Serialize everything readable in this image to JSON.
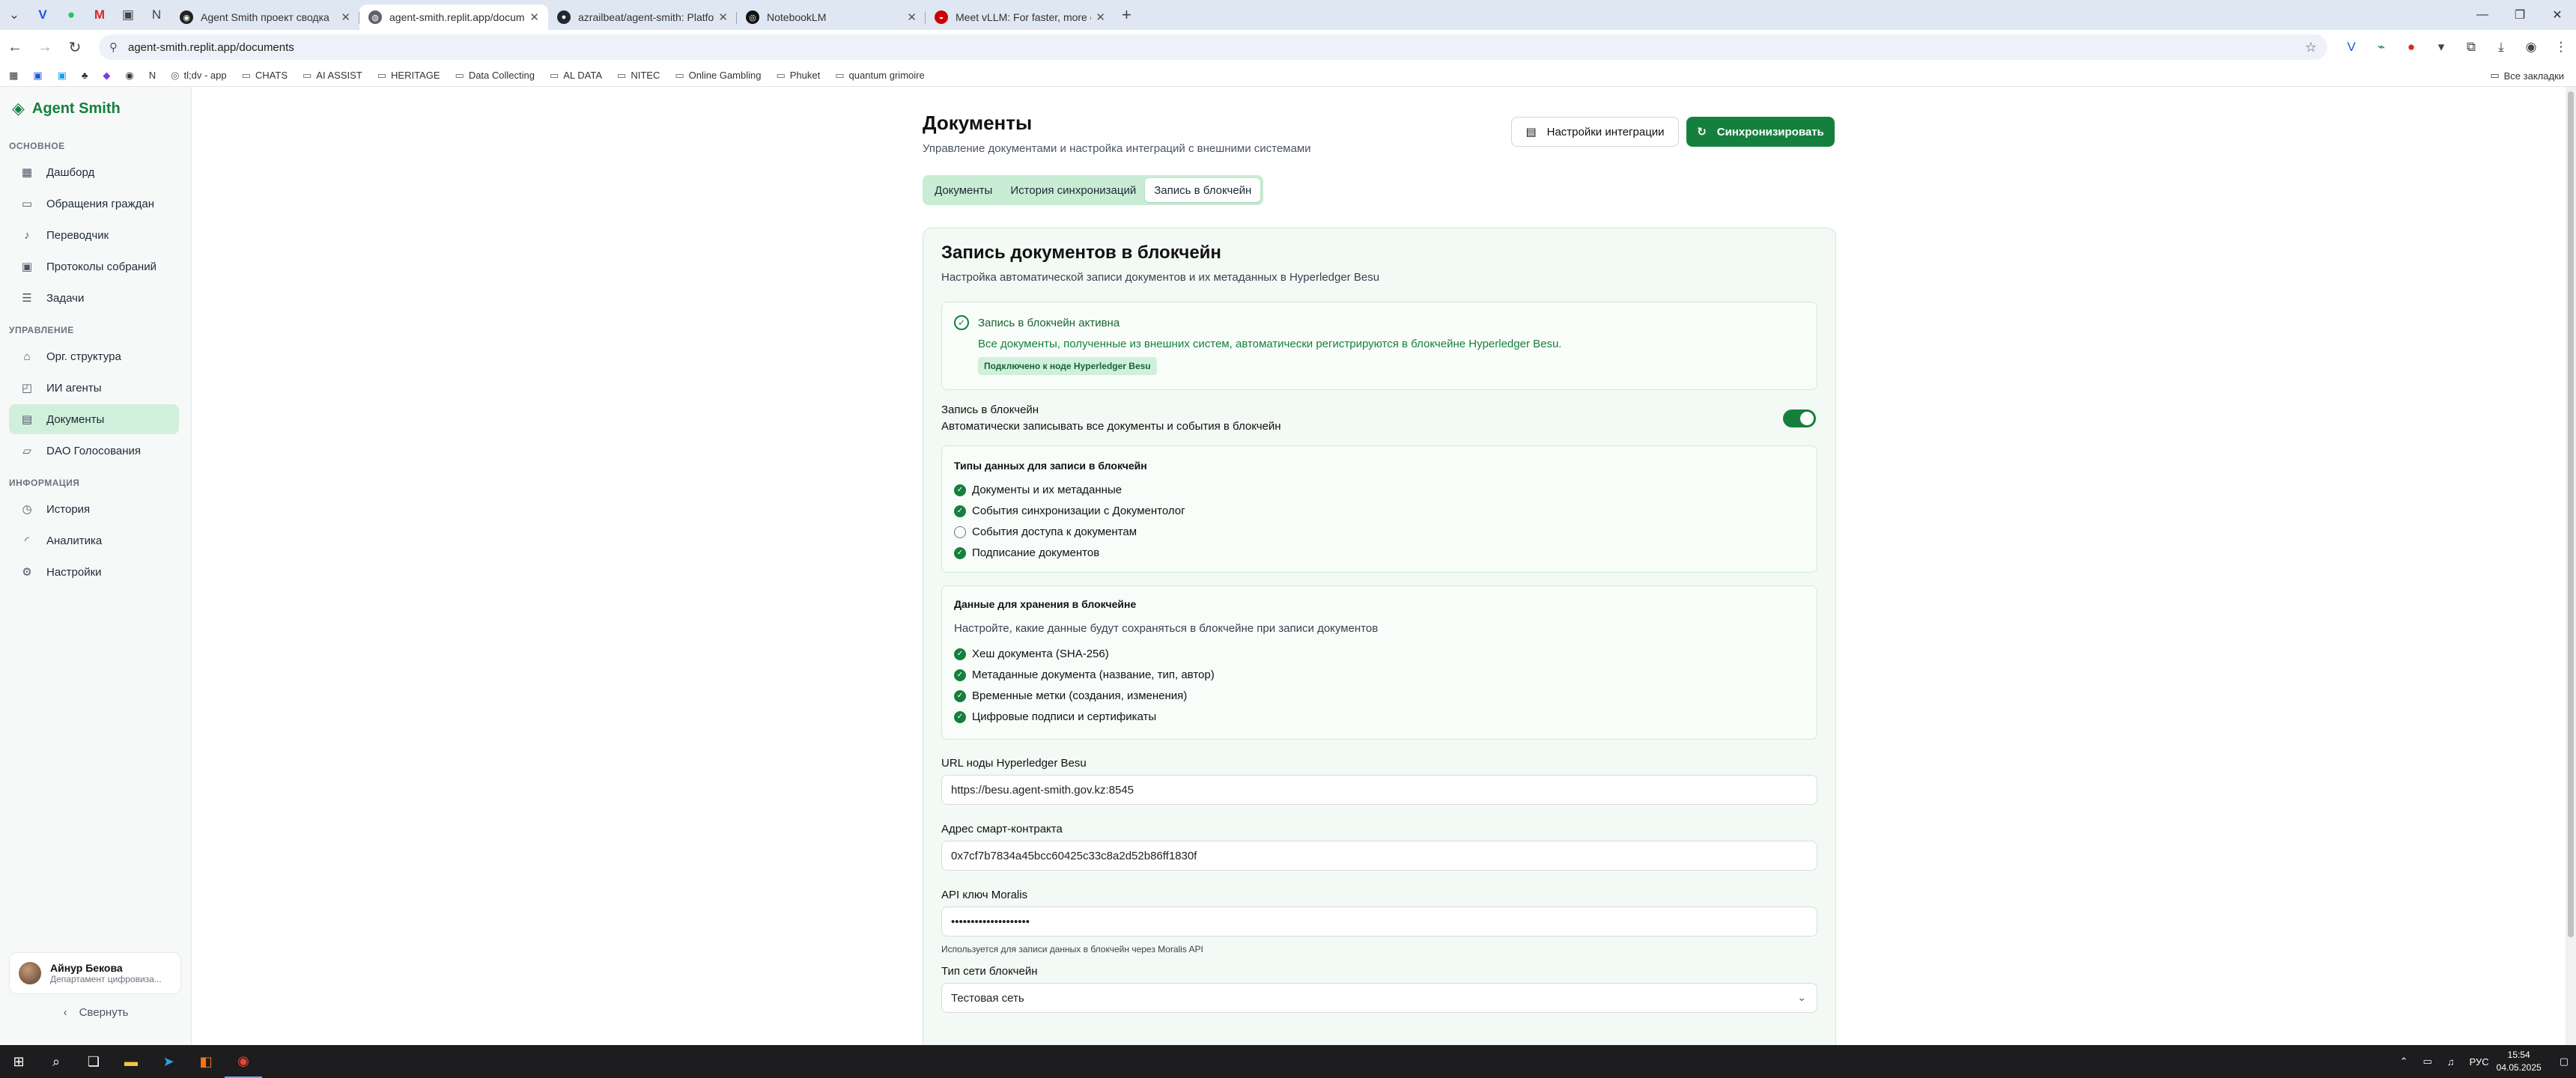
{
  "browser": {
    "tabs": [
      {
        "title": "Agent Smith проект сводка",
        "fav_color": "#222222",
        "active": false
      },
      {
        "title": "agent-smith.replit.app/documents",
        "fav_color": "#5f6368",
        "active": true
      },
      {
        "title": "azrailbeat/agent-smith: Platform",
        "fav_color": "#24292f",
        "active": false
      },
      {
        "title": "NotebookLM",
        "fav_color": "#111111",
        "active": false
      },
      {
        "title": "Meet vLLM: For faster, more efficient",
        "fav_color": "#cc0000",
        "active": false
      }
    ],
    "url": "agent-smith.replit.app/documents",
    "bookmarks": [
      "tl;dv - app",
      "CHATS",
      "AI ASSIST",
      "HERITAGE",
      "Data Collecting",
      "AL DATA",
      "NITEC",
      "Online Gambling",
      "Phuket",
      "quantum grimoire"
    ],
    "bookmarks_right": "Все закладки"
  },
  "sidebar": {
    "brand": "Agent Smith",
    "sections": [
      {
        "title": "ОСНОВНОЕ",
        "items": [
          {
            "label": "Дашборд",
            "icon": "grid-icon",
            "glyph": "▦"
          },
          {
            "label": "Обращения граждан",
            "icon": "message-icon",
            "glyph": "▭"
          },
          {
            "label": "Переводчик",
            "icon": "mic-icon",
            "glyph": "♪"
          },
          {
            "label": "Протоколы собраний",
            "icon": "calendar-icon",
            "glyph": "▣"
          },
          {
            "label": "Задачи",
            "icon": "list-checks-icon",
            "glyph": "☰"
          }
        ]
      },
      {
        "title": "УПРАВЛЕНИЕ",
        "items": [
          {
            "label": "Орг. структура",
            "icon": "building-icon",
            "glyph": "⌂"
          },
          {
            "label": "ИИ агенты",
            "icon": "bot-icon",
            "glyph": "◰"
          },
          {
            "label": "Документы",
            "icon": "file-icon",
            "glyph": "▤",
            "active": true
          },
          {
            "label": "DAO Голосования",
            "icon": "vote-icon",
            "glyph": "▱"
          }
        ]
      },
      {
        "title": "ИНФОРМАЦИЯ",
        "items": [
          {
            "label": "История",
            "icon": "history-icon",
            "glyph": "◷"
          },
          {
            "label": "Аналитика",
            "icon": "analytics-icon",
            "glyph": "◜"
          },
          {
            "label": "Настройки",
            "icon": "gear-icon",
            "glyph": "⚙"
          }
        ]
      }
    ],
    "user": {
      "name": "Айнур Бекова",
      "dept": "Департамент цифровиза..."
    },
    "collapse_label": "Свернуть"
  },
  "page": {
    "title": "Документы",
    "subtitle": "Управление документами и настройка интеграций с внешними системами",
    "btn_integration": "Настройки интеграции",
    "btn_sync": "Синхронизировать",
    "tabs": [
      "Документы",
      "История синхронизаций",
      "Запись в блокчейн"
    ],
    "active_tab": 2
  },
  "card": {
    "title": "Запись документов в блокчейн",
    "subtitle": "Настройка автоматической записи документов и их метаданных в Hyperledger Besu",
    "alert": {
      "title": "Запись в блокчейн активна",
      "text": "Все документы, полученные из внешних систем, автоматически регистрируются в блокчейне Hyperledger Besu.",
      "badge": "Подключено к ноде Hyperledger Besu"
    },
    "toggle": {
      "label": "Запись в блокчейн",
      "desc": "Автоматически записывать все документы и события в блокчейн",
      "on": true
    },
    "data_types": {
      "title": "Типы данных для записи в блокчейн",
      "items": [
        {
          "label": "Документы и их метаданные",
          "checked": true
        },
        {
          "label": "События синхронизации с Документолог",
          "checked": true
        },
        {
          "label": "События доступа к документам",
          "checked": false
        },
        {
          "label": "Подписание документов",
          "checked": true
        }
      ]
    },
    "storage": {
      "title": "Данные для хранения в блокчейне",
      "desc": "Настройте, какие данные будут сохраняться в блокчейне при записи документов",
      "items": [
        {
          "label": "Хеш документа (SHA-256)",
          "checked": true
        },
        {
          "label": "Метаданные документа (название, тип, автор)",
          "checked": true
        },
        {
          "label": "Временные метки (создания, изменения)",
          "checked": true
        },
        {
          "label": "Цифровые подписи и сертификаты",
          "checked": true
        }
      ]
    },
    "fields": {
      "node_url_label": "URL ноды Hyperledger Besu",
      "node_url": "https://besu.agent-smith.gov.kz:8545",
      "contract_label": "Адрес смарт-контракта",
      "contract": "0x7cf7b7834a45bcc60425c33c8a2d52b86ff1830f",
      "api_label": "API ключ Moralis",
      "api_value": "••••••••••••••••••••",
      "api_hint": "Используется для записи данных в блокчейн через Moralis API",
      "network_label": "Тип сети блокчейн",
      "network": "Тестовая сеть"
    }
  },
  "taskbar": {
    "lang": "РУС",
    "time": "15:54",
    "date": "04.05.2025"
  }
}
